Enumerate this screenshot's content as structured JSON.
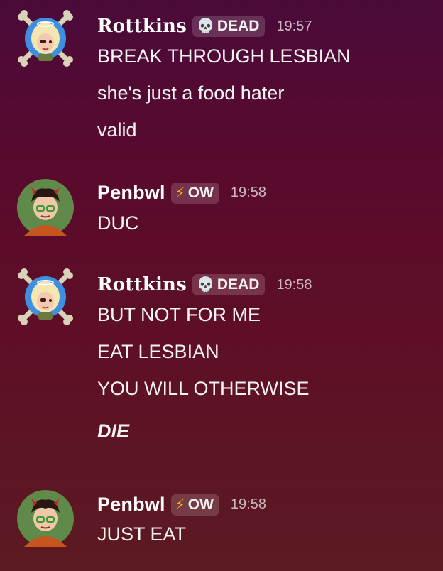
{
  "messages": [
    {
      "author": "Rottkins",
      "tag_icon": "skull-icon",
      "tag_glyph": "💀",
      "tag": "DEAD",
      "time": "19:57",
      "lines": [
        "BREAK THROUGH LESBIAN",
        "she's just a food hater",
        "valid"
      ]
    },
    {
      "author": "Penbwl",
      "tag_icon": "lightning-icon",
      "tag_glyph": "⚡",
      "tag": "OW",
      "time": "19:58",
      "lines": [
        "DUC"
      ]
    },
    {
      "author": "Rottkins",
      "tag_icon": "skull-icon",
      "tag_glyph": "💀",
      "tag": "DEAD",
      "time": "19:58",
      "lines": [
        "BUT NOT FOR ME",
        "EAT LESBIAN",
        "YOU WILL OTHERWISE",
        "DIE"
      ]
    },
    {
      "author": "Penbwl",
      "tag_icon": "lightning-icon",
      "tag_glyph": "⚡",
      "tag": "OW",
      "time": "19:58",
      "lines": [
        "JUST EAT"
      ]
    }
  ],
  "colors": {
    "background_top": "#4a0a3a",
    "background_bottom": "#5c1a22",
    "text": "#f3f3f3",
    "timestamp": "#c8b8bf"
  }
}
